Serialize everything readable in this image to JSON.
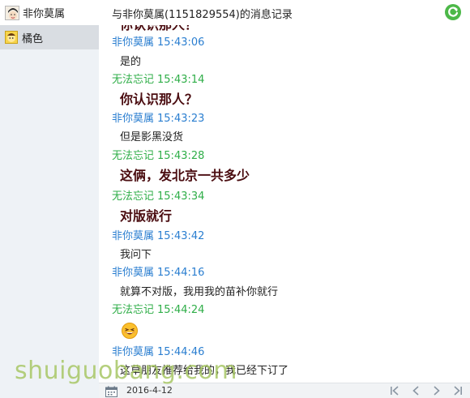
{
  "header": {
    "me_name": "非你莫属",
    "history_title": "与非你莫属(1151829554)的消息记录"
  },
  "sidebar": {
    "items": [
      {
        "label": "橘色",
        "selected": true
      }
    ]
  },
  "log": {
    "cut_top_text": "你认识那人？",
    "messages": [
      {
        "sender": "非你莫属",
        "time": "15:43:06",
        "text": "是的",
        "style": "normal",
        "color": "blue"
      },
      {
        "sender": "无法忘记",
        "time": "15:43:14",
        "text": "你认识那人？",
        "style": "big",
        "color": "green"
      },
      {
        "sender": "非你莫属",
        "time": "15:43:23",
        "text": "但是影黑没货",
        "style": "normal",
        "color": "blue"
      },
      {
        "sender": "无法忘记",
        "time": "15:43:28",
        "text": "这俩，发北京一共多少",
        "style": "big",
        "color": "green"
      },
      {
        "sender": "无法忘记",
        "time": "15:43:34",
        "text": "对版就行",
        "style": "big",
        "color": "green"
      },
      {
        "sender": "非你莫属",
        "time": "15:43:42",
        "text": "我问下",
        "style": "normal",
        "color": "blue"
      },
      {
        "sender": "非你莫属",
        "time": "15:44:16",
        "text": "就算不对版，我用我的苗补你就行",
        "style": "normal",
        "color": "blue"
      },
      {
        "sender": "无法忘记",
        "time": "15:44:24",
        "text": "",
        "style": "emoji",
        "color": "green"
      },
      {
        "sender": "非你莫属",
        "time": "15:44:46",
        "text": "这草朋友推荐给我的，我已经下订了",
        "style": "normal",
        "color": "blue"
      }
    ]
  },
  "footer": {
    "date": "2016-4-12"
  },
  "watermark": "shuiguobang.com",
  "colors": {
    "blue_sender": "#2a7ed0",
    "green_sender": "#2fae48",
    "big_text": "#4a0c10",
    "sidebar_bg": "#eef2f6"
  }
}
